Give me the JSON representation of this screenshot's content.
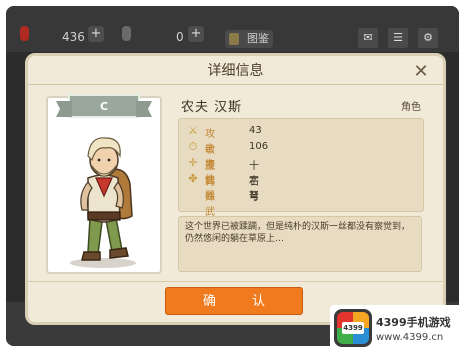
{
  "topbar": {
    "gold_count": "436",
    "gem_count": "0",
    "book_label": "图鉴",
    "plus_label": "+"
  },
  "dialog": {
    "title": "详细信息",
    "close_glyph": "✕",
    "card": {
      "rank": "C"
    },
    "character": {
      "name": "农夫  汉斯",
      "role_label": "角色"
    },
    "stats": [
      {
        "icon": "sword-icon",
        "glyph": "⚔",
        "label": "攻击力",
        "value": "43"
      },
      {
        "icon": "stopwatch-icon",
        "glyph": "⏱",
        "label": "敏捷性",
        "value": "106"
      },
      {
        "icon": "crosshair-icon",
        "glyph": "✛",
        "label": "主武器",
        "value": "十字弩"
      },
      {
        "icon": "clover-icon",
        "glyph": "✤",
        "label": "特殊武器",
        "value": "石弓"
      }
    ],
    "description": "这个世界已被蹂躏，但是纯朴的汉斯一丝都没有察觉到，仍然悠闲的躺在草原上…",
    "confirm_label": "确 认"
  },
  "watermark": {
    "badge_text": "4399",
    "line1": "4399手机游戏",
    "line2": "www.4399.cn"
  },
  "colors": {
    "dialog_bg": "#f1ead8",
    "accent_orange": "#f07a1e",
    "stat_label": "#c3862f"
  }
}
